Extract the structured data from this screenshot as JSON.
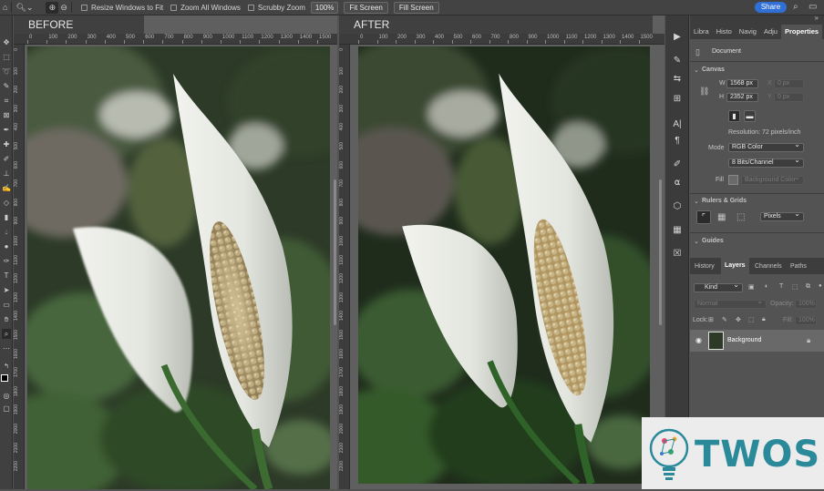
{
  "options_bar": {
    "resize_windows_label": "Resize Windows to Fit",
    "zoom_all_label": "Zoom All Windows",
    "scrubby_zoom_label": "Scrubby Zoom",
    "zoom_value": "100%",
    "fit_screen_label": "Fit Screen",
    "fill_screen_label": "Fill Screen",
    "share_label": "Share"
  },
  "documents": {
    "before_tab": "BEFORE",
    "after_tab": "AFTER",
    "before_ruler": [
      "0",
      "100",
      "200",
      "300",
      "400",
      "500",
      "600",
      "700",
      "800",
      "900",
      "1000",
      "1100",
      "1200",
      "1300",
      "1400",
      "1500"
    ],
    "after_ruler": [
      "0",
      "100",
      "200",
      "300",
      "400",
      "500",
      "600",
      "700",
      "800",
      "900",
      "1000",
      "1100",
      "1200",
      "1300",
      "1400",
      "1500"
    ],
    "vruler": [
      "0",
      "100",
      "200",
      "300",
      "400",
      "500",
      "600",
      "700",
      "800",
      "900",
      "1000",
      "1100",
      "1200",
      "1300",
      "1400",
      "1500",
      "1600",
      "1700",
      "1800",
      "1900",
      "2000",
      "2100",
      "2200",
      "2300"
    ]
  },
  "panel_tabs": [
    "Libra",
    "Histo",
    "Navig",
    "Adju",
    "Properties"
  ],
  "properties": {
    "document_label": "Document",
    "canvas_header": "Canvas",
    "w_label": "W",
    "w_value": "1568 px",
    "h_label": "H",
    "h_value": "2352 px",
    "x_label": "X",
    "x_value": "0 px",
    "y_label": "Y",
    "y_value": "0 px",
    "resolution": "Resolution: 72 pixels/inch",
    "mode_label": "Mode",
    "mode_value": "RGB Color",
    "bits_value": "8 Bits/Channel",
    "fill_label": "Fill",
    "fill_value": "Background Color",
    "rulers_header": "Rulers & Grids",
    "units_value": "Pixels",
    "guides_header": "Guides"
  },
  "layers": {
    "tabs": [
      "History",
      "Layers",
      "Channels",
      "Paths"
    ],
    "kind_label": "Kind",
    "blend_value": "Normal",
    "opacity_label": "Opacity:",
    "opacity_value": "100%",
    "lock_label": "Lock:",
    "fill_label": "Fill:",
    "fill_value": "100%",
    "layer_name": "Background"
  },
  "logo": {
    "text": "TWOS"
  },
  "colors": {
    "accent": "#2f6fd6",
    "logo_teal": "#2a8a9a",
    "logo_bg": "#ececec"
  }
}
